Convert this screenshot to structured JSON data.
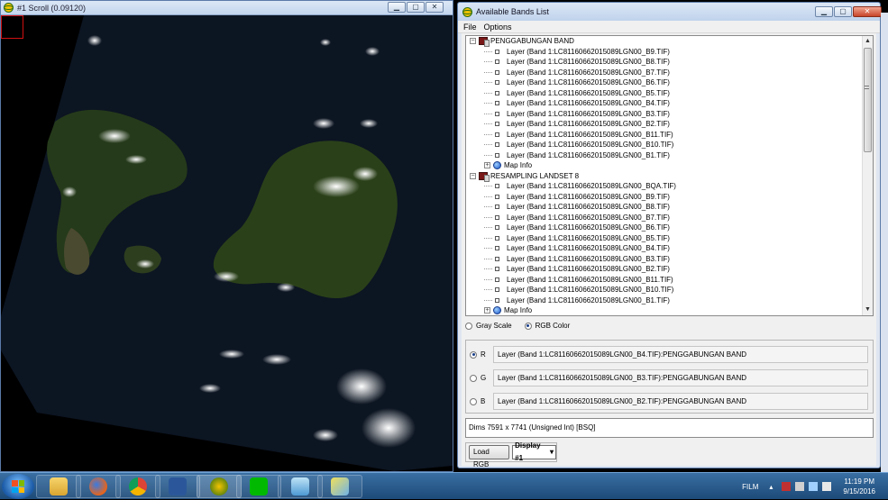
{
  "scroll_window": {
    "title": "#1 Scroll (0.09120)"
  },
  "bands_window": {
    "title": "Available Bands List",
    "menu": [
      "File",
      "Options"
    ],
    "tree": {
      "groups": [
        {
          "name": "PENGGABUNGAN BAND",
          "layers": [
            "Layer (Band 1:LC81160662015089LGN00_B9.TIF)",
            "Layer (Band 1:LC81160662015089LGN00_B8.TIF)",
            "Layer (Band 1:LC81160662015089LGN00_B7.TIF)",
            "Layer (Band 1:LC81160662015089LGN00_B6.TIF)",
            "Layer (Band 1:LC81160662015089LGN00_B5.TIF)",
            "Layer (Band 1:LC81160662015089LGN00_B4.TIF)",
            "Layer (Band 1:LC81160662015089LGN00_B3.TIF)",
            "Layer (Band 1:LC81160662015089LGN00_B2.TIF)",
            "Layer (Band 1:LC81160662015089LGN00_B11.TIF)",
            "Layer (Band 1:LC81160662015089LGN00_B10.TIF)",
            "Layer (Band 1:LC81160662015089LGN00_B1.TIF)"
          ],
          "map_info": "Map Info"
        },
        {
          "name": "RESAMPLING LANDSET 8",
          "layers": [
            "Layer (Band 1:LC81160662015089LGN00_BQA.TIF)",
            "Layer (Band 1:LC81160662015089LGN00_B9.TIF)",
            "Layer (Band 1:LC81160662015089LGN00_B8.TIF)",
            "Layer (Band 1:LC81160662015089LGN00_B7.TIF)",
            "Layer (Band 1:LC81160662015089LGN00_B6.TIF)",
            "Layer (Band 1:LC81160662015089LGN00_B5.TIF)",
            "Layer (Band 1:LC81160662015089LGN00_B4.TIF)",
            "Layer (Band 1:LC81160662015089LGN00_B3.TIF)",
            "Layer (Band 1:LC81160662015089LGN00_B2.TIF)",
            "Layer (Band 1:LC81160662015089LGN00_B11.TIF)",
            "Layer (Band 1:LC81160662015089LGN00_B10.TIF)",
            "Layer (Band 1:LC81160662015089LGN00_B1.TIF)"
          ],
          "map_info": "Map Info"
        }
      ]
    },
    "mode": {
      "gray_scale": "Gray Scale",
      "rgb_color": "RGB Color",
      "selected": "rgb"
    },
    "rgb": {
      "r_label": "R",
      "g_label": "G",
      "b_label": "B",
      "r_value": "Layer (Band 1:LC81160662015089LGN00_B4.TIF):PENGGABUNGAN BAND",
      "g_value": "Layer (Band 1:LC81160662015089LGN00_B3.TIF):PENGGABUNGAN BAND",
      "b_value": "Layer (Band 1:LC81160662015089LGN00_B2.TIF):PENGGABUNGAN BAND",
      "selected": "R"
    },
    "dims": "Dims 7591 x 7741 (Unsigned Int) [BSQ]",
    "load_button": "Load RGB",
    "display_select": "Display #1"
  },
  "taskbar": {
    "film_label": "FILM",
    "time": "11:19 PM",
    "date": "9/15/2016"
  },
  "colors": {
    "titlebar": "#c4d6ee",
    "taskbar": "#1d4a78",
    "selection_box": "#d01010"
  }
}
